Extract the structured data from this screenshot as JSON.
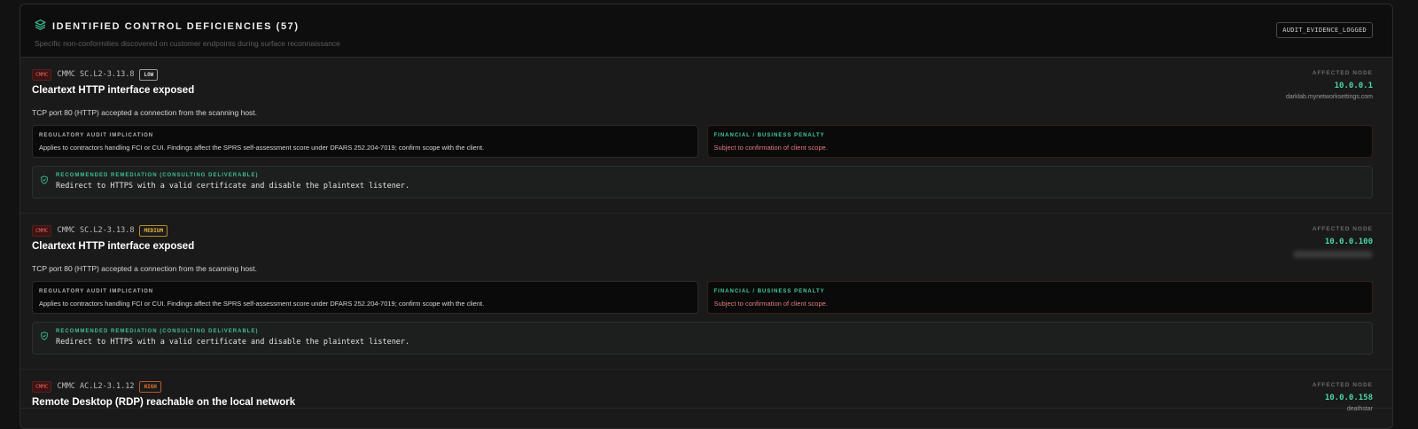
{
  "header": {
    "title": "IDENTIFIED CONTROL DEFICIENCIES (57)",
    "subtitle": "Specific non-conformities discovered on customer endpoints during surface reconnaissance",
    "audit_button": "AUDIT_EVIDENCE_LOGGED",
    "icon": "layers-icon",
    "accent": "#3fbf90"
  },
  "labels": {
    "affected_node": "AFFECTED NODE",
    "regulatory": "REGULATORY AUDIT IMPLICATION",
    "financial": "FINANCIAL / BUSINESS PENALTY",
    "remediation": "RECOMMENDED REMEDIATION (CONSULTING DELIVERABLE)"
  },
  "findings": [
    {
      "framework": "CMMC",
      "control": "CMMC SC.L2-3.13.8",
      "severity": "LOW",
      "title": "Cleartext HTTP interface exposed",
      "description": "TCP port 80 (HTTP) accepted a connection from the scanning host.",
      "ip": "10.0.0.1",
      "host": "darklab.mynetworksettings.com",
      "regulatory_text": "Applies to contractors handling FCI or CUI. Findings affect the SPRS self-assessment score under DFARS 252.204-7019; confirm scope with the client.",
      "financial_text": "Subject to confirmation of client scope.",
      "remediation_text": "Redirect to HTTPS with a valid certificate and disable the plaintext listener."
    },
    {
      "framework": "CMMC",
      "control": "CMMC SC.L2-3.13.8",
      "severity": "MEDIUM",
      "title": "Cleartext HTTP interface exposed",
      "description": "TCP port 80 (HTTP) accepted a connection from the scanning host.",
      "ip": "10.0.0.100",
      "host": "",
      "regulatory_text": "Applies to contractors handling FCI or CUI. Findings affect the SPRS self-assessment score under DFARS 252.204-7019; confirm scope with the client.",
      "financial_text": "Subject to confirmation of client scope.",
      "remediation_text": "Redirect to HTTPS with a valid certificate and disable the plaintext listener."
    },
    {
      "framework": "CMMC",
      "control": "CMMC AC.L2-3.1.12",
      "severity": "HIGH",
      "title": "Remote Desktop (RDP) reachable on the local network",
      "ip": "10.0.0.158",
      "host": "deathstar"
    }
  ]
}
